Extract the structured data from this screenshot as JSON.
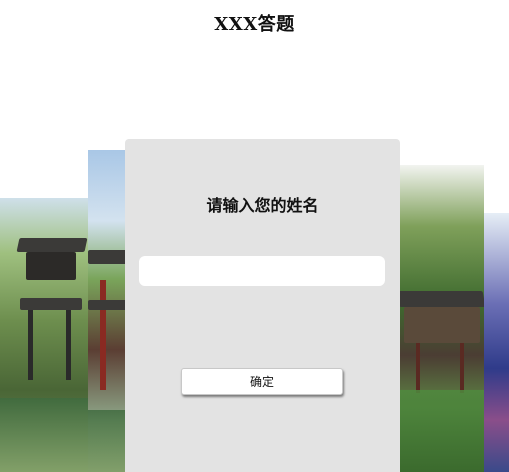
{
  "page": {
    "title": "XXX答题"
  },
  "form": {
    "prompt": "请输入您的姓名",
    "name_value": "",
    "name_placeholder": "",
    "confirm_label": "确定"
  },
  "colors": {
    "card_background": "#e3e3e3",
    "page_background": "#ffffff",
    "input_background": "#ffffff"
  },
  "background_photos": [
    {
      "subject": "garden pavilion with pond"
    },
    {
      "subject": "red-pillared pavilion"
    },
    {
      "subject": "pavilion with lotus pond"
    },
    {
      "subject": "colorful structure"
    }
  ]
}
